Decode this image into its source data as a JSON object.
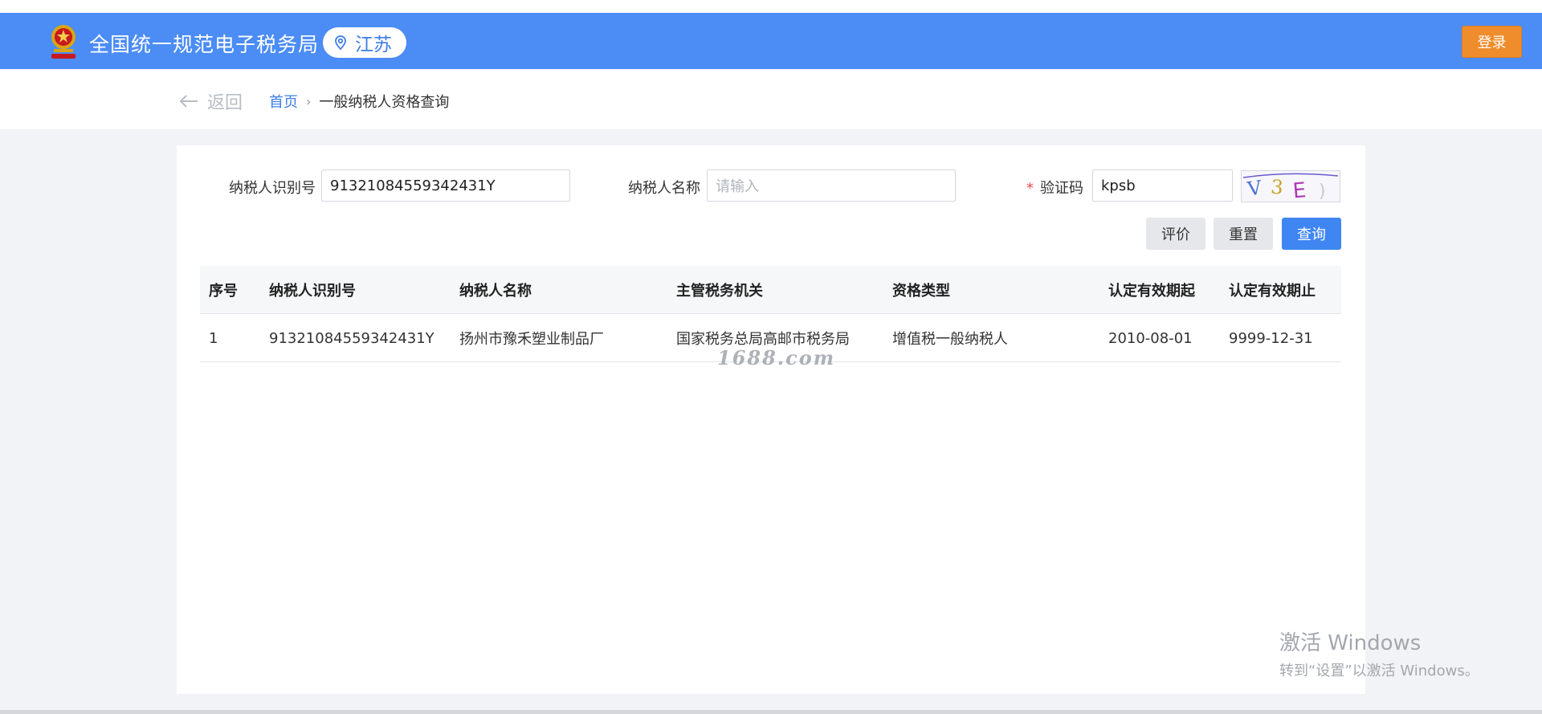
{
  "header": {
    "title": "全国统一规范电子税务局",
    "region": "江苏",
    "login_label": "登录"
  },
  "nav": {
    "back_label": "返回",
    "breadcrumb_home": "首页",
    "breadcrumb_sep": "›",
    "breadcrumb_current": "一般纳税人资格查询"
  },
  "form": {
    "taxpayer_id_label": "纳税人识别号",
    "taxpayer_id_value": "91321084559342431Y",
    "taxpayer_name_label": "纳税人名称",
    "taxpayer_name_placeholder": "请输入",
    "captcha_required_mark": "*",
    "captcha_label": "验证码",
    "captcha_value": "kpsb",
    "captcha_image_text": "V3E)"
  },
  "buttons": {
    "evaluate": "评价",
    "reset": "重置",
    "query": "查询"
  },
  "table": {
    "columns": [
      "序号",
      "纳税人识别号",
      "纳税人名称",
      "主管税务机关",
      "资格类型",
      "认定有效期起",
      "认定有效期止"
    ],
    "rows": [
      [
        "1",
        "91321084559342431Y",
        "扬州市豫禾塑业制品厂",
        "国家税务总局高邮市税务局",
        "增值税一般纳税人",
        "2010-08-01",
        "9999-12-31"
      ]
    ]
  },
  "overlay": {
    "watermark_1688": "1688.com",
    "activate_title": "激活 Windows",
    "activate_sub": "转到“设置”以激活 Windows。"
  },
  "colors": {
    "header_bg": "#4b8cf5",
    "login_bg": "#ef8c2c",
    "primary": "#3f86f2",
    "link": "#3c7de9"
  }
}
